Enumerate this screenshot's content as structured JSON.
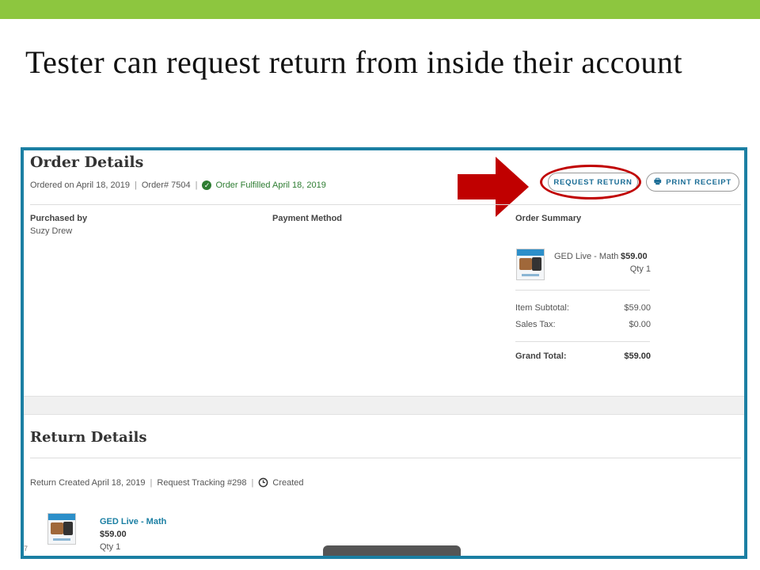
{
  "slide": {
    "title": "Tester can request return from inside their account",
    "number": "7",
    "accent_color": "#8dc63f",
    "frame_color": "#1b7fa3",
    "highlight_color": "#c00000"
  },
  "order": {
    "title": "Order Details",
    "ordered_on": "Ordered on April 18, 2019",
    "order_number": "Order# 7504",
    "status_icon": "check-circle-icon",
    "status": "Order Fulfilled April 18, 2019",
    "purchased_by_label": "Purchased by",
    "purchased_by": "Suzy Drew",
    "payment_method_label": "Payment Method",
    "summary": {
      "label": "Order Summary",
      "item_name": "GED Live - Math",
      "item_price": "$59.00",
      "item_qty": "Qty 1",
      "subtotal_label": "Item Subtotal:",
      "subtotal": "$59.00",
      "tax_label": "Sales Tax:",
      "tax": "$0.00",
      "grand_total_label": "Grand Total:",
      "grand_total": "$59.00"
    }
  },
  "buttons": {
    "request_return": "REQUEST RETURN",
    "print_receipt": "PRINT RECEIPT",
    "print_icon": "printer-icon"
  },
  "separator": "|",
  "return_details": {
    "title": "Return Details",
    "created": "Return Created April 18, 2019",
    "tracking": "Request Tracking #298",
    "status_icon": "clock-icon",
    "status": "Created",
    "item_name": "GED Live - Math",
    "item_price": "$59.00",
    "item_qty": "Qty 1"
  }
}
